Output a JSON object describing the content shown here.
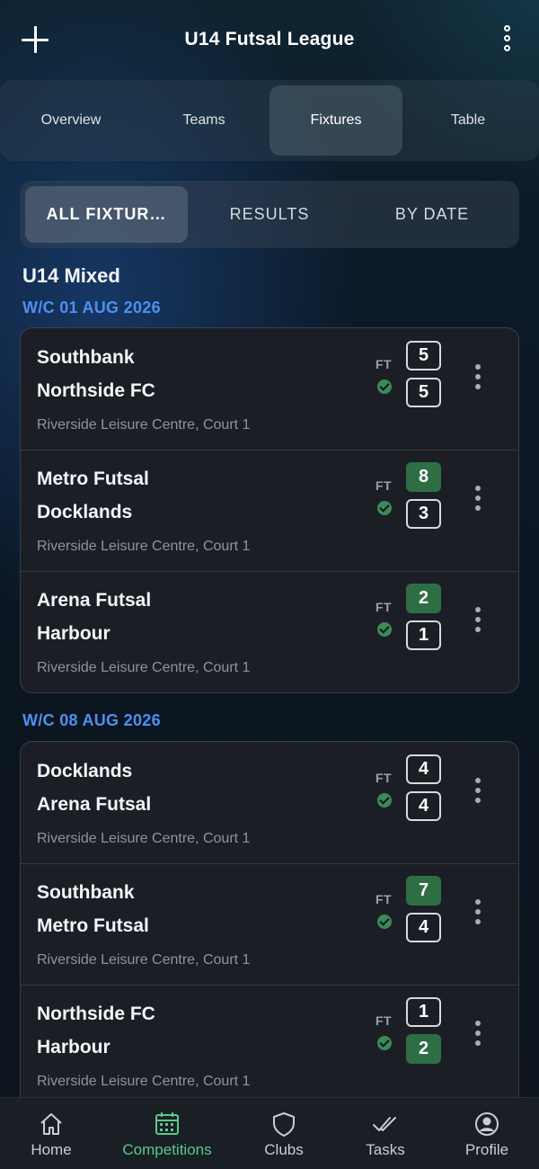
{
  "header": {
    "title": "U14 Futsal League",
    "add_icon": "plus-icon",
    "more_icon": "more-vertical-icon"
  },
  "tabs": [
    {
      "label": "Overview",
      "active": false
    },
    {
      "label": "Teams",
      "active": false
    },
    {
      "label": "Fixtures",
      "active": true
    },
    {
      "label": "Table",
      "active": false
    }
  ],
  "segments": [
    {
      "label": "ALL FIXTUR…",
      "active": true
    },
    {
      "label": "RESULTS",
      "active": false
    },
    {
      "label": "BY DATE",
      "active": false
    }
  ],
  "section_title": "U14 Mixed",
  "weeks": [
    {
      "label": "W/C 01 AUG 2026",
      "matches": [
        {
          "home": "Southbank",
          "away": "Northside FC",
          "venue": "Riverside Leisure Centre, Court 1",
          "status": "FT",
          "home_score": "5",
          "away_score": "5",
          "winner": "draw"
        },
        {
          "home": "Metro Futsal",
          "away": "Docklands",
          "venue": "Riverside Leisure Centre, Court 1",
          "status": "FT",
          "home_score": "8",
          "away_score": "3",
          "winner": "home"
        },
        {
          "home": "Arena Futsal",
          "away": "Harbour",
          "venue": "Riverside Leisure Centre, Court 1",
          "status": "FT",
          "home_score": "2",
          "away_score": "1",
          "winner": "home"
        }
      ]
    },
    {
      "label": "W/C 08 AUG 2026",
      "matches": [
        {
          "home": "Docklands",
          "away": "Arena Futsal",
          "venue": "Riverside Leisure Centre, Court 1",
          "status": "FT",
          "home_score": "4",
          "away_score": "4",
          "winner": "draw"
        },
        {
          "home": "Southbank",
          "away": "Metro Futsal",
          "venue": "Riverside Leisure Centre, Court 1",
          "status": "FT",
          "home_score": "7",
          "away_score": "4",
          "winner": "home"
        },
        {
          "home": "Northside FC",
          "away": "Harbour",
          "venue": "Riverside Leisure Centre, Court 1",
          "status": "FT",
          "home_score": "1",
          "away_score": "2",
          "winner": "away"
        }
      ]
    }
  ],
  "bottom_nav": [
    {
      "label": "Home",
      "icon": "home-icon",
      "active": false
    },
    {
      "label": "Competitions",
      "icon": "calendar-icon",
      "active": true
    },
    {
      "label": "Clubs",
      "icon": "shield-icon",
      "active": false
    },
    {
      "label": "Tasks",
      "icon": "double-check-icon",
      "active": false
    },
    {
      "label": "Profile",
      "icon": "profile-icon",
      "active": false
    }
  ],
  "colors": {
    "accent_blue": "#4f8ff0",
    "win_green": "#2f6e45",
    "active_nav": "#5bc98a",
    "card_bg": "#1b1f25"
  }
}
